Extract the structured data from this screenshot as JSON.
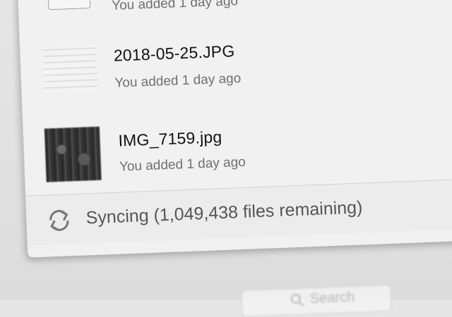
{
  "files": [
    {
      "name": "",
      "meta": "You added 1 day ago",
      "thumb": "blank"
    },
    {
      "name": "2018-05-25.JPG",
      "meta": "You added 1 day ago",
      "thumb": "document"
    },
    {
      "name": "IMG_7159.jpg",
      "meta": "You added 1 day ago",
      "thumb": "photo"
    }
  ],
  "status": {
    "icon": "sync-icon",
    "text": "Syncing (1,049,438 files remaining)"
  },
  "search": {
    "placeholder": "Search",
    "icon": "search-icon"
  }
}
